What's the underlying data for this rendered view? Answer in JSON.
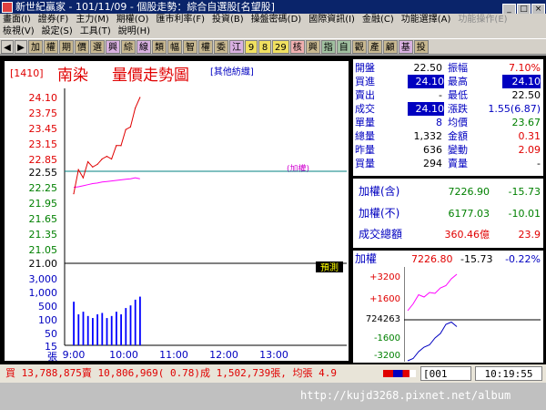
{
  "window": {
    "title": "新世紀贏家 - 101/11/09 - 個股走勢：綜合自選股[名望股]"
  },
  "menu_row1": [
    "畫面(I)",
    "證券(F)",
    "主力(M)",
    "期權(O)",
    "匯市利率(F)",
    "投資(B)",
    "操盤密碼(D)",
    "國際資訊(I)",
    "金融(C)",
    "功能選擇(A)",
    "功能操作(E)"
  ],
  "menu_row2": [
    "檢視(V)",
    "設定(S)",
    "工具(T)",
    "說明(H)"
  ],
  "toolbar": [
    "加",
    "權",
    "期",
    "價",
    "選",
    "興",
    "綜",
    "線",
    "類",
    "幅",
    "智",
    "權",
    "委",
    "江",
    "9",
    "8",
    "29",
    "核",
    "興",
    "指",
    "自",
    "觀",
    "產",
    "顧",
    "基",
    "投"
  ],
  "chart": {
    "code": "[1410]",
    "name": "南染",
    "title": "量價走勢圖",
    "category": "[其他紡織]",
    "index_label": "(加權)",
    "forecast_label": "預測",
    "price_ticks": [
      "24.10",
      "23.75",
      "23.45",
      "23.15",
      "22.85",
      "22.55",
      "22.25",
      "21.95",
      "21.65",
      "21.35",
      "21.05",
      "21.00"
    ],
    "volume_ticks": [
      "3,000",
      "1,000",
      "500",
      "100",
      "50",
      "15"
    ],
    "volume_unit": "張",
    "time_ticks": [
      "9:00",
      "10:00",
      "11:00",
      "12:00",
      "13:00"
    ]
  },
  "chart_data": {
    "type": "line",
    "title": "量價走勢圖",
    "ylim": [
      21.0,
      24.1
    ],
    "x": [
      "9:00",
      "9:05",
      "9:10",
      "9:15",
      "9:20",
      "9:25",
      "9:30",
      "9:35",
      "9:40",
      "9:45",
      "9:50",
      "9:55",
      "10:00",
      "10:05",
      "10:10"
    ],
    "series": [
      {
        "name": "成交",
        "values": [
          22.3,
          22.75,
          22.6,
          22.9,
          22.8,
          22.85,
          22.95,
          23.0,
          22.95,
          23.2,
          23.2,
          23.5,
          23.55,
          23.9,
          24.1
        ]
      }
    ],
    "index_series": [
      22.42,
      22.43,
      22.45,
      22.47,
      22.49,
      22.5,
      22.52,
      22.53,
      22.54,
      22.55,
      22.56,
      22.57,
      22.58,
      22.6,
      22.58
    ],
    "volume": [
      120,
      30,
      40,
      25,
      20,
      30,
      35,
      20,
      25,
      40,
      30,
      60,
      80,
      150,
      210
    ],
    "reference_price": 22.5
  },
  "quote": {
    "rows": [
      {
        "l1": "開盤",
        "v1": "22.50",
        "l2": "振幅",
        "v2": "7.10%"
      },
      {
        "l1": "買進",
        "v1": "24.10",
        "l2": "最高",
        "v2": "24.10"
      },
      {
        "l1": "賣出",
        "v1": "-",
        "l2": "最低",
        "v2": "22.50"
      },
      {
        "l1": "成交",
        "v1": "24.10",
        "l2": "漲跌",
        "v2": "1.55(6.87)"
      },
      {
        "l1": "單量",
        "v1": "8",
        "l2": "均價",
        "v2": "23.67"
      },
      {
        "l1": "總量",
        "v1": "1,332",
        "l2": "金額",
        "v2": "0.31"
      },
      {
        "l1": "昨量",
        "v1": "636",
        "l2": "變動",
        "v2": "2.09"
      },
      {
        "l1": "買量",
        "v1": "294",
        "l2": "賣量",
        "v2": "-"
      }
    ]
  },
  "index_box": [
    {
      "label": "加權(含)",
      "value": "7226.90",
      "change": "-15.73"
    },
    {
      "label": "加權(不)",
      "value": "6177.03",
      "change": "-10.01"
    },
    {
      "label": "成交總額",
      "value": "360.46億",
      "change": "23.9"
    }
  ],
  "mini_chart": {
    "title": "加權",
    "value": "7226.80",
    "change": "-15.73",
    "pct": "-0.22%",
    "y_ticks": [
      "+3200",
      "+1600",
      "724263",
      "-1600",
      "-3200"
    ]
  },
  "mini_chart_data": {
    "type": "line",
    "series": [
      {
        "name": "magenta",
        "values": [
          0.2,
          0.35,
          0.55,
          0.5,
          0.6,
          0.58,
          0.7,
          0.75,
          0.9,
          1.0
        ]
      },
      {
        "name": "blue",
        "values": [
          -0.9,
          -0.85,
          -0.7,
          -0.6,
          -0.55,
          -0.4,
          -0.3,
          -0.1,
          -0.05,
          -0.15
        ]
      }
    ]
  },
  "status": {
    "ticker_text": "買 13,788,875賣 10,806,969( 0.78)成 1,502,739張, 均張 4.9",
    "page": "[001",
    "clock": "10:19:55"
  },
  "watermark": {
    "url": "http://kujd3268.pixnet.net/album"
  },
  "colors": {
    "up": "#e00000",
    "down": "#008000",
    "volume": "#0000ff",
    "index_line": "#ff00ff",
    "bg_black": "#000000"
  }
}
